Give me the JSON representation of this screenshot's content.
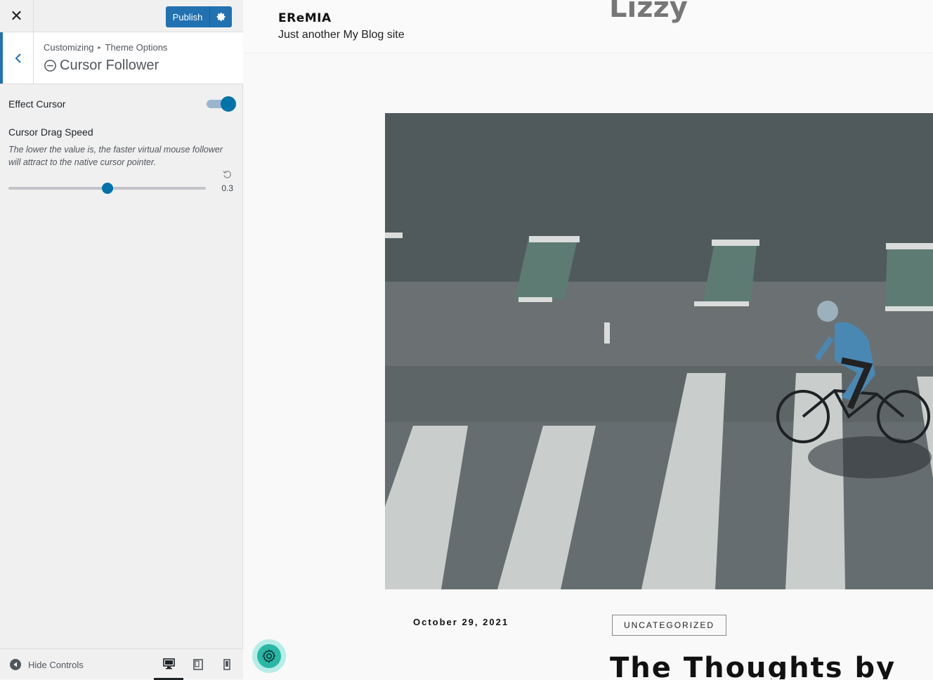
{
  "topbar": {
    "close_symbol": "✕",
    "publish_label": "Publish"
  },
  "section": {
    "breadcrumb_root": "Customizing",
    "breadcrumb_sep": "▸",
    "breadcrumb_parent": "Theme Options",
    "title": "Cursor Follower"
  },
  "controls": {
    "effect_cursor_label": "Effect Cursor",
    "effect_cursor_enabled": true,
    "drag_speed_label": "Cursor Drag Speed",
    "drag_speed_desc": "The lower the value is, the faster virtual mouse follower will attract to the native cursor pointer.",
    "drag_speed_value": "0.3",
    "drag_speed_fraction": 0.5
  },
  "footer": {
    "hide_controls_label": "Hide Controls",
    "devices": [
      "desktop",
      "tablet",
      "mobile"
    ],
    "active_device": "desktop"
  },
  "preview": {
    "site_logo": "EReMIA",
    "site_tagline": "Just another My Blog site",
    "menu_name": "Lizzy",
    "post_date": "October 29, 2021",
    "post_category": "UNCATEGORIZED",
    "post_title": "The Thoughts by"
  },
  "colors": {
    "accent": "#2271b1",
    "toggle_on": "#0073aa",
    "fab": "#2ab7a6"
  }
}
